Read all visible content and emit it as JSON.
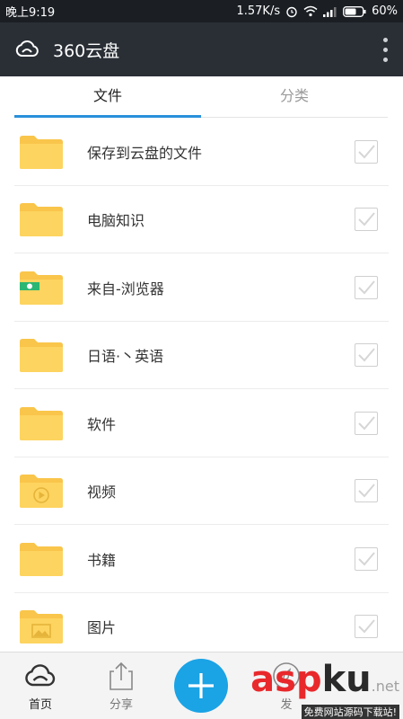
{
  "status_bar": {
    "time": "晚上9:19",
    "speed": "1.57K/s",
    "battery": "60%"
  },
  "app_bar": {
    "title": "360云盘"
  },
  "tabs": [
    {
      "label": "文件",
      "active": true
    },
    {
      "label": "分类",
      "active": false
    }
  ],
  "files": [
    {
      "name": "保存到云盘的文件",
      "icon": "folder-icon",
      "checked": false
    },
    {
      "name": "电脑知识",
      "icon": "folder-icon",
      "checked": false
    },
    {
      "name": "来自-浏览器",
      "icon": "browser-folder-icon",
      "checked": false
    },
    {
      "name": "日语·丶英语",
      "icon": "folder-icon",
      "checked": false
    },
    {
      "name": "软件",
      "icon": "folder-icon",
      "checked": false
    },
    {
      "name": "视频",
      "icon": "video-folder-icon",
      "checked": false
    },
    {
      "name": "书籍",
      "icon": "folder-icon",
      "checked": false
    },
    {
      "name": "图片",
      "icon": "image-folder-icon",
      "checked": false
    }
  ],
  "bottom_nav": {
    "home_label": "首页",
    "share_label": "分享",
    "discover_label": "发"
  },
  "watermark": {
    "logo_asp": "asp",
    "logo_ku": "ku",
    "logo_net": ".net",
    "subtitle": "免费网站源码下载站!"
  },
  "colors": {
    "accent": "#2a90db",
    "fab": "#1aa3e5",
    "folder": "#fdd45f",
    "app_bar": "#2a2f36"
  }
}
